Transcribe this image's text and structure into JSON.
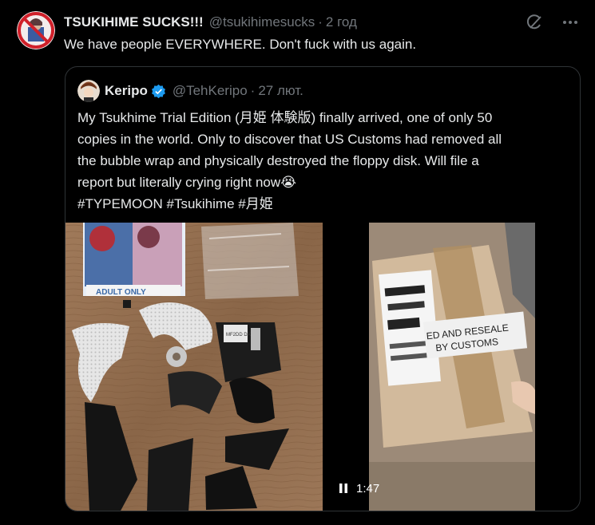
{
  "post": {
    "display_name": "TSUKIHIME SUCKS!!!",
    "handle": "@tsukihimesucks",
    "time": "2 год",
    "text": "We have people EVERYWHERE. Don't fuck with us again.",
    "icons": [
      "grok-icon",
      "more-icon"
    ]
  },
  "quote": {
    "display_name": "Keripo",
    "handle": "@TehKeripo",
    "time": "27 лют.",
    "verified": true,
    "text_lines": [
      "My Tsukhime Trial Edition (月姫 体験版) finally arrived, one of only 50",
      "copies in the world. Only to discover that US Customs had removed all",
      "the bubble wrap and physically destroyed the floppy disk. Will file a",
      "report but literally crying right now😭"
    ],
    "hashtags": [
      "#TYPEMOON",
      "#Tsukihime",
      "#月姫"
    ],
    "media": {
      "left_photo_label_1": "ADULT ONLY",
      "floppy_label": "MF2DD DATA",
      "package_label_1": "ED AND RESEALE",
      "package_label_2": "BY CUSTOMS",
      "video_duration": "1:47",
      "video_state": "pause-icon"
    }
  },
  "colors": {
    "background": "#000000",
    "text": "#e7e9ea",
    "muted": "#71767b",
    "border": "#2f3336",
    "verified": "#1d9bf0"
  }
}
